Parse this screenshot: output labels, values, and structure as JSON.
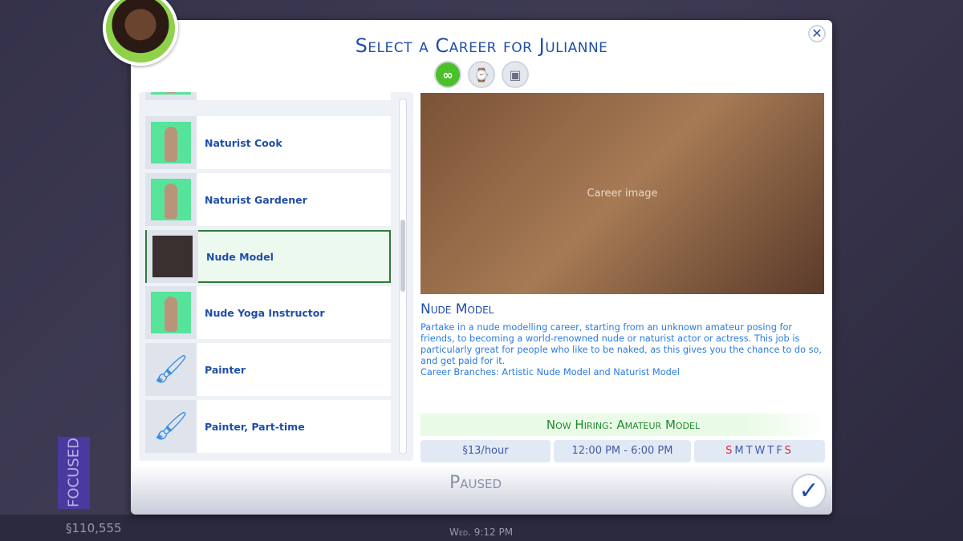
{
  "background": {
    "focused": "FOCUSED",
    "paused": "Paused",
    "money": "§110,555",
    "time": "Wed. 9:12 PM"
  },
  "dialog": {
    "title": "Select a Career for Julianne",
    "filters": [
      {
        "icon": "infinity-icon",
        "active": true
      },
      {
        "icon": "part-time-briefcase-icon",
        "active": false
      },
      {
        "icon": "briefcase-icon",
        "active": false
      }
    ],
    "careers": [
      {
        "label": "Naturist Cook",
        "thumb": "green"
      },
      {
        "label": "Naturist Gardener",
        "thumb": "green"
      },
      {
        "label": "Nude Model",
        "thumb": "dark",
        "selected": true
      },
      {
        "label": "Nude Yoga Instructor",
        "thumb": "green"
      },
      {
        "label": "Painter",
        "thumb": "brush"
      },
      {
        "label": "Painter, Part-time",
        "thumb": "brush"
      }
    ],
    "detail": {
      "image_alt": "Career image",
      "name": "Nude Model",
      "description": "Partake in a nude modelling career, starting from an unknown amateur posing for friends, to becoming a world-renowned nude or naturist actor or actress. This job is particularly great for people who like to be naked, as this gives you the chance to do so, and get paid for it.",
      "branches": "Career Branches: Artistic Nude Model and Naturist Model",
      "hiring": "Now Hiring: Amateur Model",
      "pay": "§13/hour",
      "hours": "12:00  PM - 6:00  PM",
      "days": [
        "S",
        "M",
        "T",
        "W",
        "T",
        "F",
        "S"
      ],
      "work_days_highlight": "#d8283a"
    },
    "accent": "#1f4ea8"
  }
}
